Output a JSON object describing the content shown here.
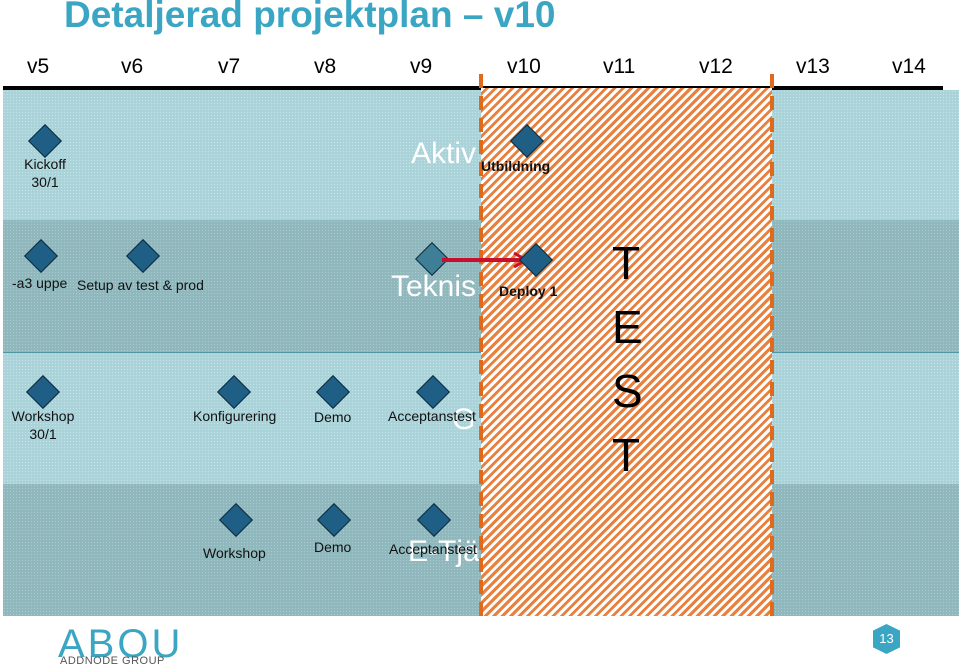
{
  "title": "Detaljerad projektplan – v10",
  "weeks": [
    "v5",
    "v6",
    "v7",
    "v8",
    "v9",
    "v10",
    "v11",
    "v12",
    "v13",
    "v14"
  ],
  "lanes": [
    {
      "name": "Aktiv",
      "milestones": [
        {
          "label": "Kickoff\n30/1"
        },
        {
          "label": "Utbildning"
        }
      ]
    },
    {
      "name": "Teknis",
      "milestones": [
        {
          "label": "-a3 uppe"
        },
        {
          "label": "Setup av test & prod"
        },
        {
          "label": ""
        },
        {
          "label": "Deploy 1"
        }
      ]
    },
    {
      "name": "G",
      "milestones": [
        {
          "label": "Workshop\n30/1"
        },
        {
          "label": "Konfigurering"
        },
        {
          "label": "Demo"
        },
        {
          "label": "Acceptanstest"
        }
      ]
    },
    {
      "name": "E-Tjä",
      "milestones": [
        {
          "label": "Workshop"
        },
        {
          "label": "Demo"
        },
        {
          "label": "Acceptanstest"
        }
      ]
    }
  ],
  "test_block": {
    "letters": [
      "T",
      "E",
      "S",
      "T"
    ],
    "from_week": "v10",
    "to_week": "v12"
  },
  "footer": {
    "logo": "ABOU",
    "logo_sub": "ADDNODE GROUP",
    "page_number": "13"
  },
  "colors": {
    "accent": "#3aa6c4",
    "milestone": "#1f5f86",
    "hatch": "#e8813f",
    "arrow": "#c8102e"
  }
}
